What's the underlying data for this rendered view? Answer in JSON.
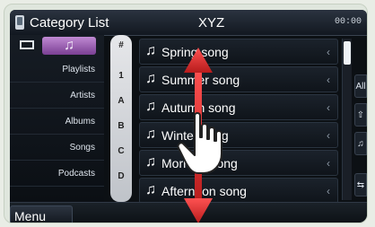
{
  "header": {
    "title": "Category List",
    "center_text": "XYZ",
    "time": "00:00"
  },
  "tabs": {
    "music_icon": "music-note-icon",
    "video_icon": "video-icon"
  },
  "categories": [
    "Playlists",
    "Artists",
    "Albums",
    "Songs",
    "Podcasts"
  ],
  "index": [
    "#",
    "1",
    "A",
    "B",
    "C",
    "D"
  ],
  "songs": [
    "Spring song",
    "Summer song",
    "Autumn song",
    "Winter song",
    "Morning song",
    "Afternoon song"
  ],
  "row_chevron": "‹",
  "right_buttons": [
    "All",
    "⇧",
    "♫",
    "⇆"
  ],
  "bottom": {
    "menu_label": "Menu"
  },
  "gesture": {
    "type": "vertical-swipe",
    "arrow_color": "#e53935"
  }
}
